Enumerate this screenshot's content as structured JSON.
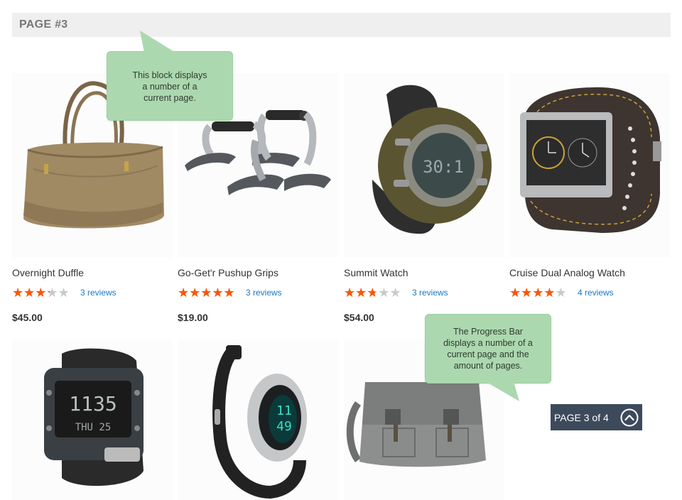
{
  "header": {
    "label": "PAGE #3"
  },
  "tooltips": {
    "page_block": [
      "This block displays",
      "a number of a",
      "current page."
    ],
    "progress_bar": [
      "The Progress Bar",
      "displays a number of a",
      "current page and the",
      "amount of pages."
    ]
  },
  "products": [
    {
      "name": "Overnight Duffle",
      "rating": 3,
      "reviews": "3 reviews",
      "price": "$45.00",
      "icon": "duffle-bag-image"
    },
    {
      "name": "Go-Get'r Pushup Grips",
      "rating": 4.5,
      "reviews": "3 reviews",
      "price": "$19.00",
      "icon": "pushup-grips-image"
    },
    {
      "name": "Summit Watch",
      "rating": 2.5,
      "reviews": "3 reviews",
      "price": "$54.00",
      "icon": "sport-watch-image"
    },
    {
      "name": "Cruise Dual Analog Watch",
      "rating": 3.5,
      "reviews": "4 reviews",
      "price": null,
      "icon": "analog-watch-image"
    },
    {
      "icon": "digital-watch-image",
      "display_time": "1135",
      "display_date": "THU 25"
    },
    {
      "icon": "bangle-watch-image",
      "display_top": "11",
      "display_bottom": "49"
    },
    {
      "icon": "messenger-bag-image"
    }
  ],
  "progress": {
    "label": "PAGE 3 of 4",
    "current": 3,
    "total": 4,
    "icon": "chevron-up-icon"
  },
  "colors": {
    "star_active": "#ff5501",
    "star_inactive": "#c9c9c9",
    "link": "#1979c3",
    "tooltip": "#acd8af",
    "progress_bg": "#3d4a5c",
    "header_bg": "#efefef"
  }
}
